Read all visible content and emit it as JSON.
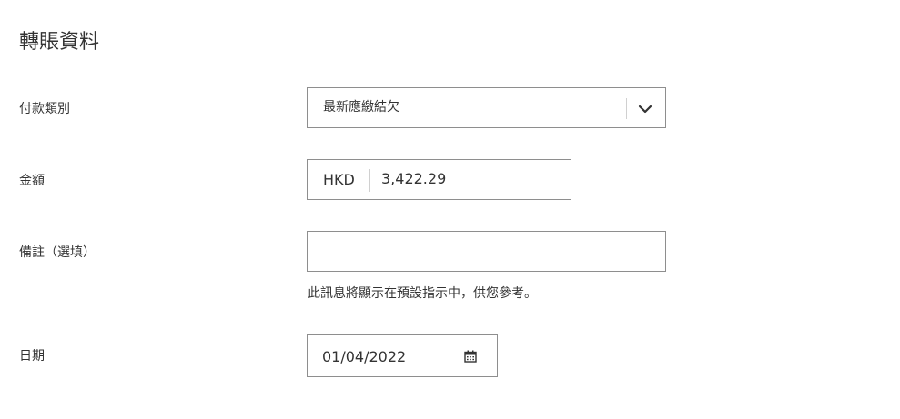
{
  "form": {
    "title": "轉賬資料",
    "payment_type": {
      "label": "付款類別",
      "selected": "最新應繳結欠"
    },
    "amount": {
      "label": "金額",
      "currency": "HKD",
      "value": "3,422.29"
    },
    "remark": {
      "label": "備註（選填）",
      "value": "",
      "hint": "此訊息將顯示在預設指示中，供您參考。"
    },
    "date": {
      "label": "日期",
      "value": "01/04/2022"
    }
  },
  "icons": {
    "dropdown": "chevron-down-icon",
    "date": "calendar-icon"
  }
}
